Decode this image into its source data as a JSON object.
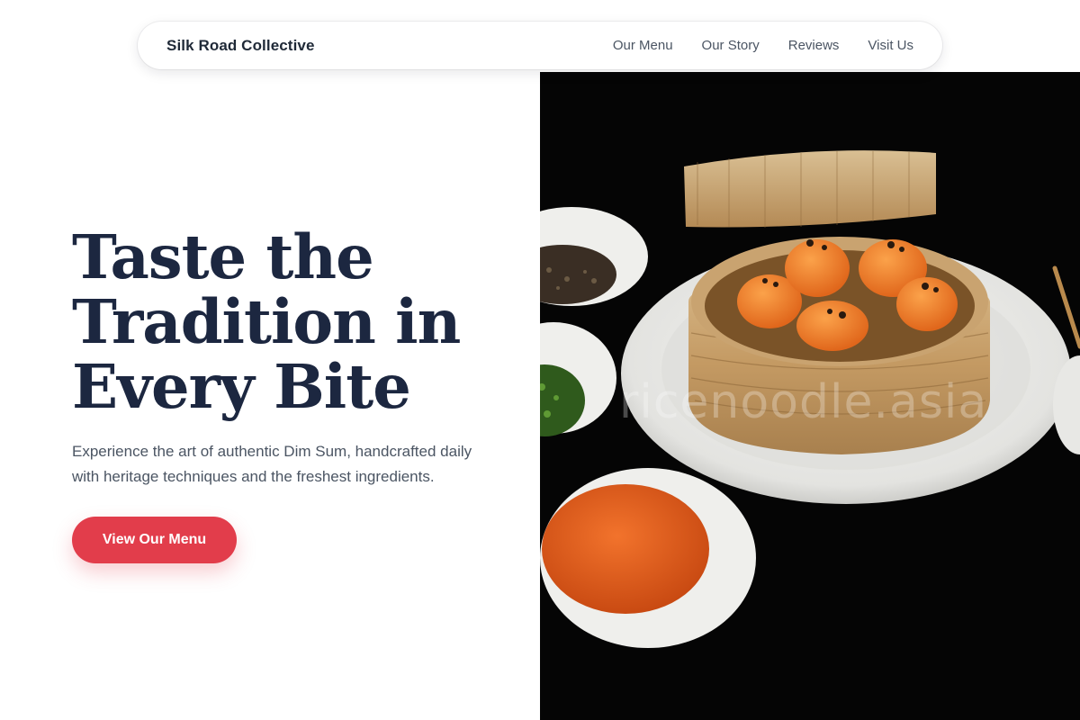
{
  "nav": {
    "brand": "Silk Road Collective",
    "links": [
      "Our Menu",
      "Our Story",
      "Reviews",
      "Visit Us"
    ]
  },
  "hero": {
    "headline_lines": [
      "Taste the",
      "Tradition in",
      "Every Bite"
    ],
    "subtitle": "Experience the art of authentic Dim Sum, handcrafted daily with heritage techniques and the freshest ingredients.",
    "cta_label": "View Our Menu"
  },
  "image": {
    "watermark": "ricenoodle.asia",
    "description_icon": "dim-sum-steamer-photo"
  },
  "colors": {
    "accent": "#e23d4b",
    "headline": "#1c2740",
    "body_text": "#4b5563"
  }
}
